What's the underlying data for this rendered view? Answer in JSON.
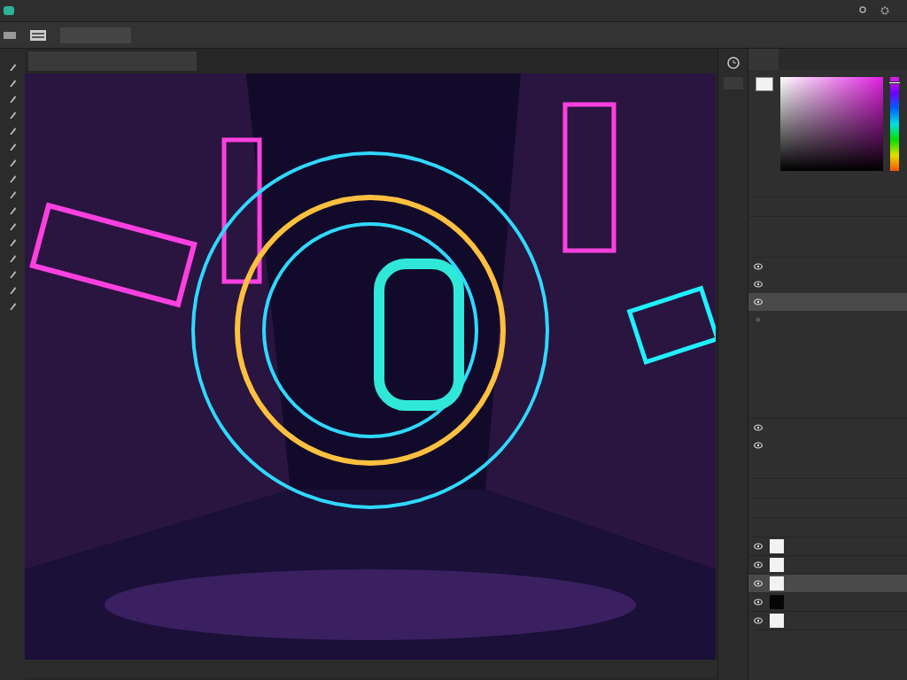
{
  "hue_slider": {
    "level": 0.05
  },
  "upper_layers": [
    {
      "visible": true,
      "selected": false
    },
    {
      "visible": true,
      "selected": false
    },
    {
      "visible": true,
      "selected": true
    },
    {
      "visible": false,
      "selected": false
    }
  ],
  "properties": [
    {
      "visible": true
    },
    {
      "visible": true
    }
  ],
  "layers": [
    {
      "visible": true,
      "selected": false,
      "color": "#f2f2f2"
    },
    {
      "visible": true,
      "selected": false,
      "color": "#f2f2f2"
    },
    {
      "visible": true,
      "selected": true,
      "color": "#f2f2f2"
    },
    {
      "visible": true,
      "selected": false,
      "color": "#050505"
    },
    {
      "visible": true,
      "selected": false,
      "color": "#f2f2f2"
    }
  ]
}
